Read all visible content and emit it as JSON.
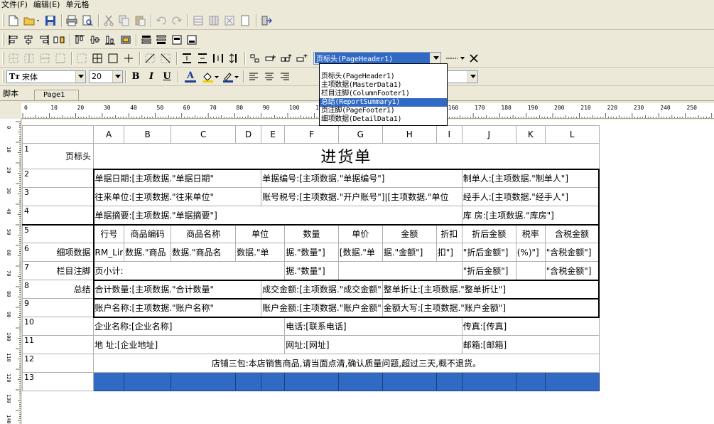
{
  "menu": [
    "文件(F)",
    "编辑(E)",
    "单元格"
  ],
  "font_name": "宋体",
  "font_size": "20",
  "band_combo": "页标头(PageHeader1)",
  "band_options": [
    "页标头(PageHeader1)",
    "主项数据(MasterData1)",
    "栏目注脚(ColumnFooter1)",
    "总结(ReportSummary1)",
    "页注脚(PageFooter1)",
    "细项数据(DetailData1)"
  ],
  "band_selected_index": 3,
  "format_bold": "B",
  "format_italic": "I",
  "format_underline": "U",
  "font_color_letter": "A",
  "tabs": {
    "script": "脚本",
    "page": "Page1"
  },
  "ruler_h": [
    "0",
    "10",
    "20",
    "30",
    "40",
    "50",
    "60",
    "70",
    "80",
    "90",
    "100",
    "110",
    "120",
    "130",
    "140",
    "150",
    "160",
    "170",
    "180",
    "190",
    "200",
    "210",
    "220",
    "230",
    "240",
    "250"
  ],
  "ruler_v": [
    "0",
    "10",
    "20",
    "30",
    "40",
    "50",
    "60",
    "70",
    "80",
    "90",
    "100",
    "110",
    "120",
    "130",
    "140"
  ],
  "columns": [
    "A",
    "B",
    "C",
    "D",
    "E",
    "F",
    "G",
    "H",
    "I",
    "J",
    "K",
    "L"
  ],
  "rows": {
    "r1": {
      "num": "1",
      "band": "页标头",
      "title": "进货单"
    },
    "r2": {
      "num": "2",
      "a": "单据日期:[主项数据.\"单据日期\"",
      "b": "单据编号:[主项数据.\"单据编号\"]",
      "c": "制单人:[主项数据.\"制单人\"]"
    },
    "r3": {
      "num": "3",
      "a": "往来单位:[主项数据.\"往来单位\"",
      "b": "账号税号:[主项数据.\"开户账号\"]|[主项数据.\"单位",
      "c": "经手人:[主项数据.\"经手人\"]"
    },
    "r4": {
      "num": "4",
      "a": "单据摘要:[主项数据.\"单据摘要\"]",
      "c": "库  房:[主项数据.\"库房\"]"
    },
    "r5": {
      "num": "5",
      "cells": [
        "行号",
        "商品编码",
        "商品名称",
        "单位",
        "",
        "数量",
        "单价",
        "金额",
        "折扣",
        "折后金额",
        "税率",
        "含税金额"
      ]
    },
    "r6": {
      "num": "6",
      "band": "细项数据",
      "cells": [
        "RM_Lir",
        "数据.\"商品",
        "数据.\"商品名",
        "数据.\"单",
        "",
        "据.\"数量\"]",
        "[数据.\"单",
        "据.\"金额\"]",
        "扣\"]",
        "\"折后金额\"]",
        "(%)\"]",
        "\"含税金额\"]"
      ]
    },
    "r7": {
      "num": "7",
      "band": "栏目注脚",
      "a": "页小计:",
      "qty": "据.\"数量\"]",
      "disc": "\"折后金额\"]",
      "tax": "\"含税金额\"]"
    },
    "r8": {
      "num": "8",
      "band": "总结",
      "a": "合计数量:[主项数据.\"合计数量\"",
      "b": "成交金额:[主项数据.\"成交金额\"",
      "c": "整单折让:[主项数据.\"整单折让\"]"
    },
    "r9": {
      "num": "9",
      "a": "账户名称:[主项数据.\"账户名称\"",
      "b": "账户金额:[主项数据.\"账户金额\"",
      "c": "金额大写:[主项数据.\"账户金额\"]"
    },
    "r10": {
      "num": "10",
      "a": "企业名称:[企业名称]",
      "b": "电话:[联系电话]",
      "c": "传真:[传真]"
    },
    "r11": {
      "num": "11",
      "a": "地   址:[企业地址]",
      "b": "网址:[网址]",
      "c": "邮箱:[邮箱]"
    },
    "r12": {
      "num": "12",
      "a": "店铺三包:本店销售商品,请当面点清,确认质量问题,超过三天,概不退货。"
    },
    "r13": {
      "num": "13"
    }
  },
  "colors": {
    "selection": "#316ac5",
    "chrome": "#ece9d8"
  }
}
